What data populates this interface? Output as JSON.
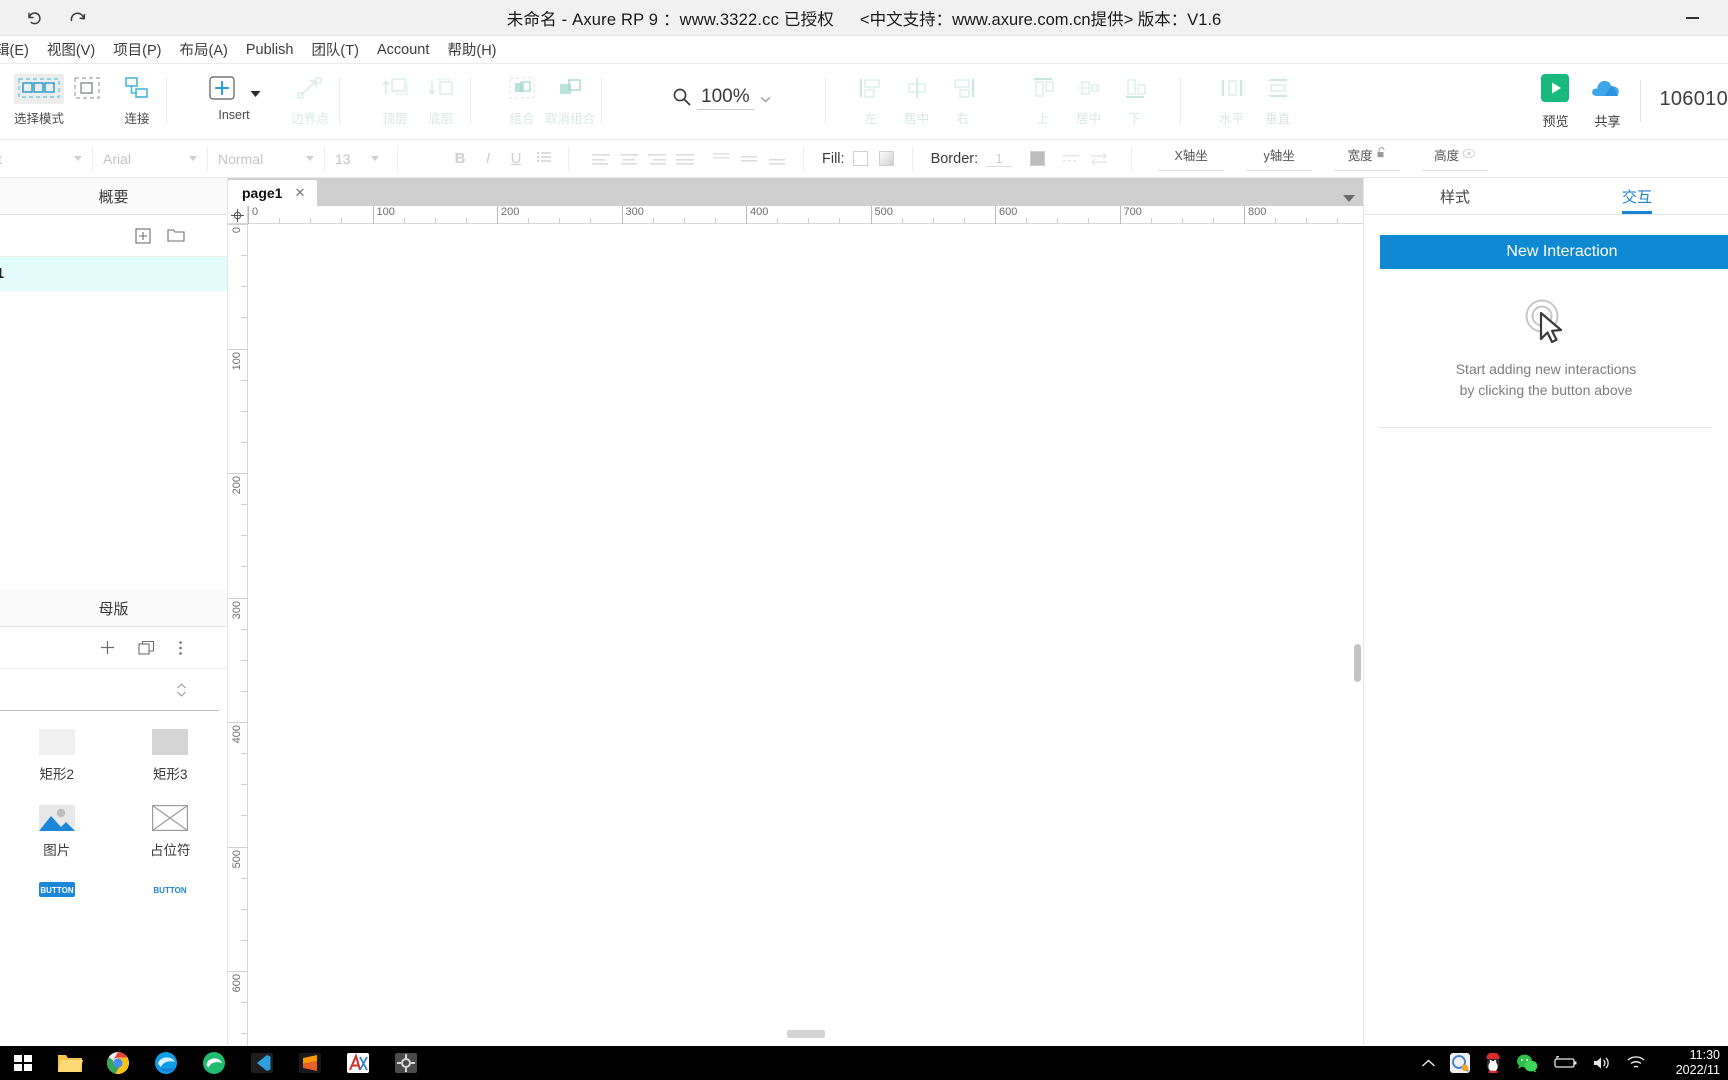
{
  "titlebar": {
    "undo_icon": "undo-arrow-icon",
    "redo_icon": "redo-arrow-icon",
    "title": "未命名 - Axure RP 9 ：www.3322.cc 已授权",
    "subtitle": "<中文支持：www.axure.com.cn提供> 版本：V1.6",
    "minimize_label": "—"
  },
  "menubar": {
    "items": [
      {
        "label": "辑(E)"
      },
      {
        "label": "视图(V)"
      },
      {
        "label": "项目(P)"
      },
      {
        "label": "布局(A)"
      },
      {
        "label": "Publish"
      },
      {
        "label": "团队(T)"
      },
      {
        "label": "Account"
      },
      {
        "label": "帮助(H)"
      }
    ]
  },
  "toolbar": {
    "select_mode": "选择模式",
    "connect": "连接",
    "insert": "Insert",
    "edge_point": "边界点",
    "bring_front": "顶层",
    "send_back": "底层",
    "group": "组合",
    "ungroup": "取消组合",
    "zoom_value": "100%",
    "align_left": "左",
    "align_center": "居中",
    "align_right": "右",
    "align_top": "上",
    "align_middle": "居中",
    "align_bottom": "下",
    "dist_h": "水平",
    "dist_v": "垂直",
    "preview": "预览",
    "share": "共享",
    "account_number": "106010"
  },
  "formatbar": {
    "style_value": "t",
    "font_value": "Arial",
    "weight_value": "Normal",
    "size_value": "13",
    "color_icon": "text-color-icon",
    "bold": "B",
    "italic": "I",
    "underline": "U",
    "list_icon": "bullet-list-icon",
    "fill_label": "Fill:",
    "border_label": "Border:",
    "border_width": "1",
    "x_label": "X轴坐",
    "y_label": "y轴坐",
    "w_label": "宽度",
    "h_label": "高度"
  },
  "leftpanel": {
    "outline_title": "概要",
    "outline_add_icon": "add-box-icon",
    "outline_folder_icon": "folder-icon",
    "outline_selected_row": "1",
    "masters_title": "母版",
    "masters_add_icon": "plus-icon",
    "masters_copy_icon": "duplicate-icon",
    "masters_more_icon": "more-vertical-icon",
    "masters_items": [
      {
        "name": "矩形2",
        "icon": "rectangle-light-icon"
      },
      {
        "name": "矩形3",
        "icon": "rectangle-grey-icon"
      },
      {
        "name": "图片",
        "icon": "image-icon"
      },
      {
        "name": "占位符",
        "icon": "placeholder-icon"
      },
      {
        "name": "BUTTON",
        "icon": "button-filled-icon"
      },
      {
        "name": "BUTTON",
        "icon": "button-text-icon"
      }
    ]
  },
  "canvas": {
    "tab_label": "page1",
    "tab_close_icon": "close-icon",
    "ruler_h_ticks": [
      "0",
      "100",
      "200",
      "300",
      "400",
      "500",
      "600",
      "700",
      "800"
    ],
    "ruler_v_ticks": [
      "0",
      "100",
      "200",
      "300",
      "400",
      "500",
      "600"
    ],
    "origin_icon": "ruler-origin-icon"
  },
  "rightpanel": {
    "tab_style": "样式",
    "tab_interactions": "交互",
    "new_interaction_button": "New Interaction",
    "empty_icon": "click-cursor-icon",
    "empty_line1": "Start adding new interactions",
    "empty_line2": "by clicking the button above"
  },
  "taskbar": {
    "start_icon": "windows-start-icon",
    "apps": [
      {
        "icon": "file-explorer-icon"
      },
      {
        "icon": "chrome-icon"
      },
      {
        "icon": "edge-icon"
      },
      {
        "icon": "edge-legacy-icon"
      },
      {
        "icon": "vscode-icon"
      },
      {
        "icon": "sublime-icon"
      },
      {
        "icon": "axure-icon"
      },
      {
        "icon": "settings-icon"
      }
    ],
    "tray": [
      {
        "icon": "chevron-up-icon"
      },
      {
        "icon": "qq-browser-icon"
      },
      {
        "icon": "qq-penguin-icon"
      },
      {
        "icon": "wechat-icon"
      },
      {
        "icon": "battery-icon"
      },
      {
        "icon": "volume-icon"
      },
      {
        "icon": "wifi-icon"
      }
    ],
    "time": "11:30",
    "date": "2022/11"
  },
  "colors": {
    "accent_blue": "#1089d3",
    "teal_icon": "#4ec8b0",
    "selected_row": "#e2fbfb",
    "preview_green": "#17b97f",
    "share_blue": "#3da5e8"
  }
}
